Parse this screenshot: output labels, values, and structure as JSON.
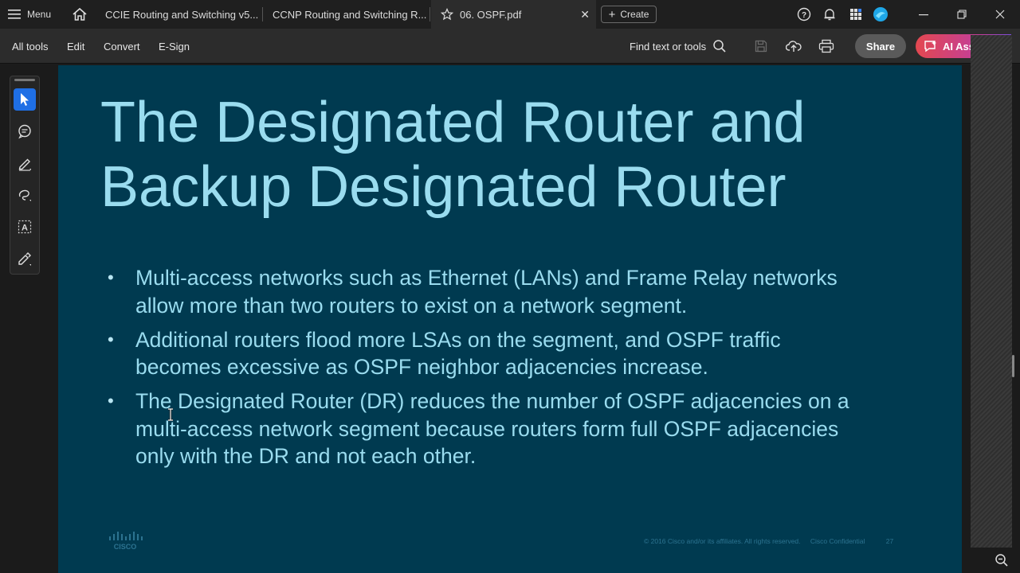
{
  "titlebar": {
    "menu_label": "Menu",
    "tabs": [
      {
        "label": "CCIE Routing and Switching v5..."
      },
      {
        "label": "CCNP Routing and Switching R..."
      },
      {
        "label": "06. OSPF.pdf",
        "active": true
      }
    ],
    "create_label": "Create",
    "icons": [
      "menu-icon",
      "home-icon",
      "star-icon",
      "close-icon",
      "plus-icon",
      "help-icon",
      "bell-icon",
      "apps-icon",
      "profile-icon",
      "minimize-icon",
      "restore-icon",
      "window-close-icon"
    ]
  },
  "toolbar": {
    "menus": [
      "All tools",
      "Edit",
      "Convert",
      "E-Sign"
    ],
    "find_label": "Find text or tools",
    "share_label": "Share",
    "ai_label": "AI Ass"
  },
  "rail": {
    "tools": [
      "select-tool-icon",
      "comment-tool-icon",
      "highlight-tool-icon",
      "draw-tool-icon",
      "text-tool-icon",
      "sign-tool-icon"
    ]
  },
  "slide": {
    "title_line1": "The Designated Router and",
    "title_line2": "Backup Designated Router",
    "bullets": [
      "Multi-access networks such as Ethernet (LANs) and Frame Relay networks allow more than two routers to exist on a network segment.",
      "Additional routers flood more LSAs on the segment, and OSPF traffic becomes excessive as OSPF neighbor adjacencies increase.",
      "The Designated Router (DR) reduces the number of OSPF adjacencies on a multi-access network segment because routers form full OSPF adjacencies only with the DR and not each other."
    ],
    "logo_text": "CISCO",
    "footer_copyright": "© 2016  Cisco and/or its affiliates. All rights reserved.",
    "footer_confidential": "Cisco Confidential",
    "page_number": "27"
  },
  "colors": {
    "slide_bg": "#003a50",
    "slide_text": "#9adcef",
    "active_tool": "#1f6fe5"
  }
}
